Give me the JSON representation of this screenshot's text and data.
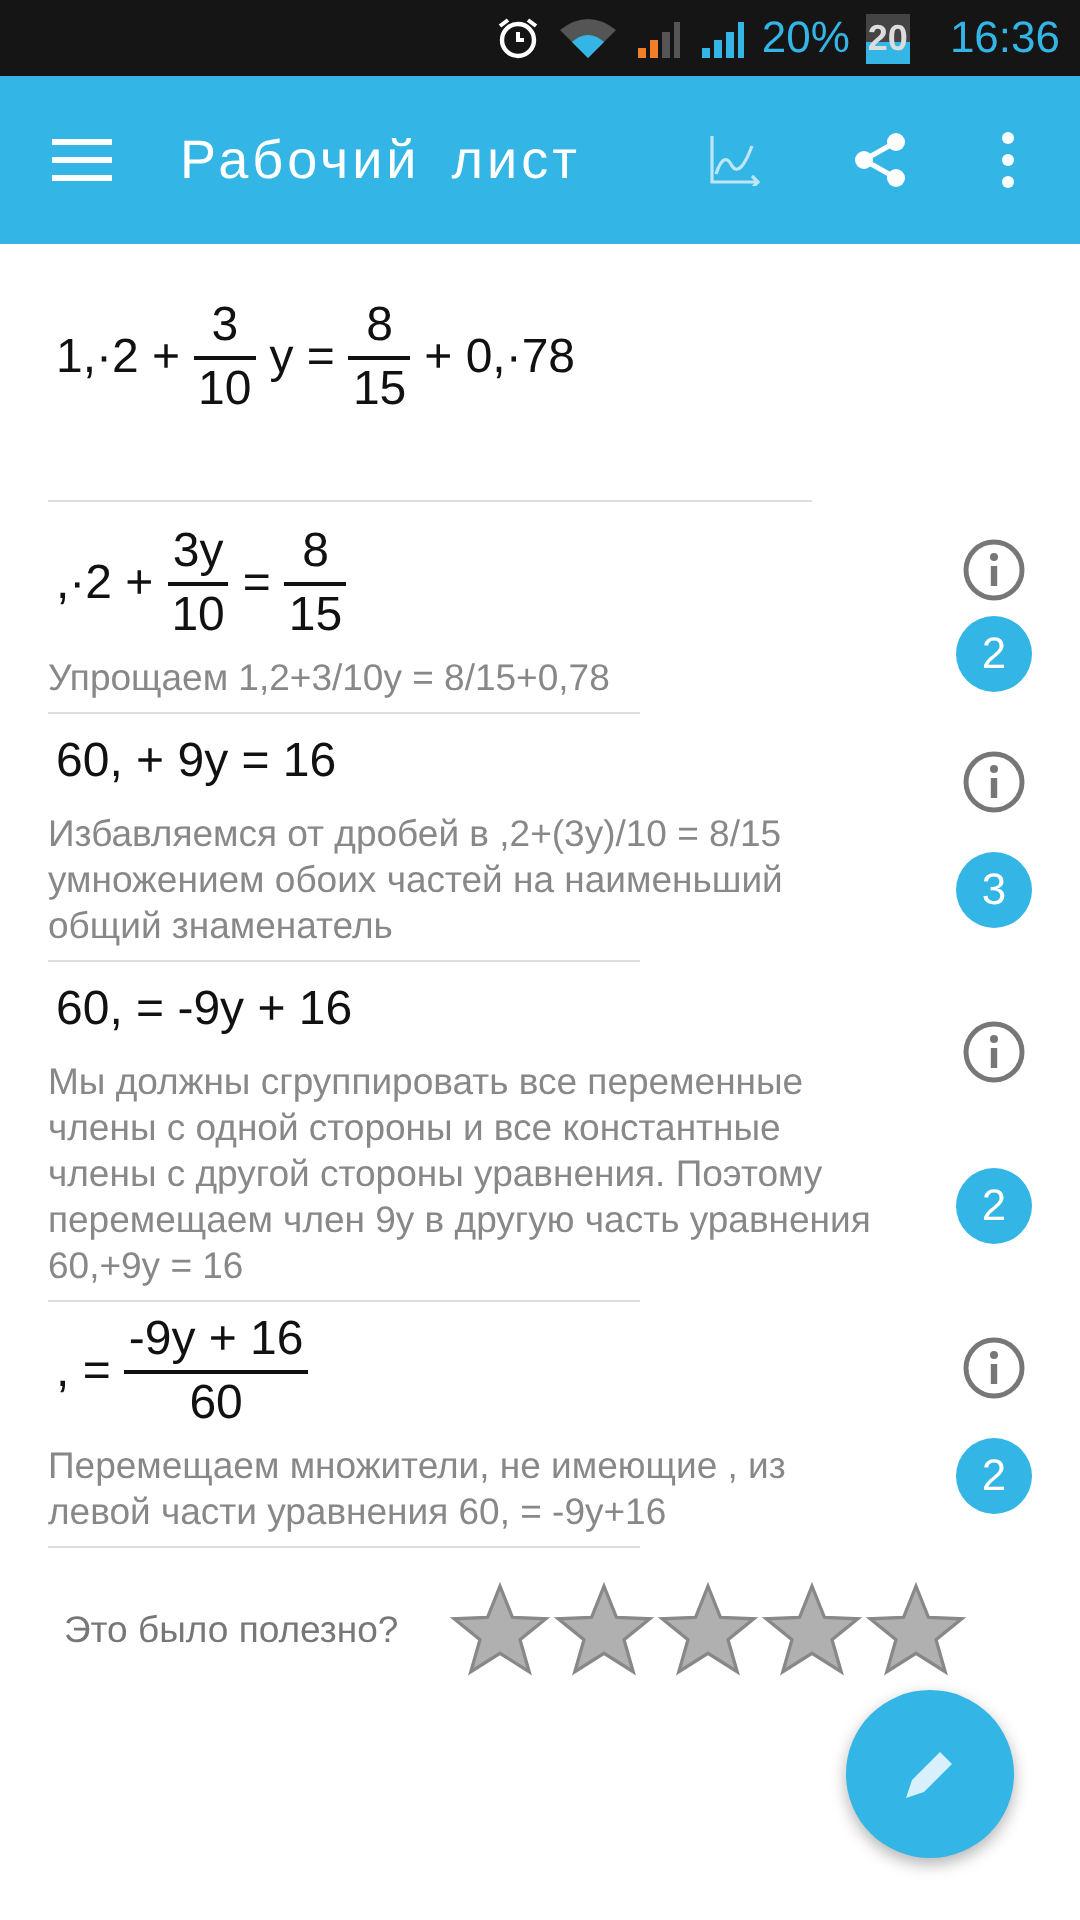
{
  "status_bar": {
    "battery_percent": "20%",
    "battery_level_text": "20",
    "time": "16:36"
  },
  "app_bar": {
    "title": "Рабочий лист"
  },
  "equation": [
    {
      "kind": "text",
      "text": "1,·2 +"
    },
    {
      "kind": "frac",
      "num": "3",
      "den": "10"
    },
    {
      "kind": "text",
      "text": "y ="
    },
    {
      "kind": "frac",
      "num": "8",
      "den": "15"
    },
    {
      "kind": "text",
      "text": "+ 0,·78"
    }
  ],
  "steps": [
    {
      "expression": [
        {
          "kind": "text",
          "text": ",·2 +"
        },
        {
          "kind": "frac",
          "num": "3y",
          "den": "10"
        },
        {
          "kind": "text",
          "text": "="
        },
        {
          "kind": "frac",
          "num": "8",
          "den": "15"
        }
      ],
      "explanation": "Упрощаем 1,2+3/10y = 8/15+0,78",
      "badge": "2"
    },
    {
      "expression": [
        {
          "kind": "text",
          "text": "60, + 9y = 16"
        }
      ],
      "explanation": "Избавляемся от дробей в ,2+(3y)/10 = 8/15 умножением обоих частей на наименьший общий знаменатель",
      "badge": "3"
    },
    {
      "expression": [
        {
          "kind": "text",
          "text": "60, = -9y + 16"
        }
      ],
      "explanation": "Мы должны сгруппировать все переменные члены с одной стороны и все константные члены с другой стороны уравнения. Поэтому перемещаем член 9y в другую часть уравнения 60,+9y = 16",
      "badge": "2"
    },
    {
      "expression": [
        {
          "kind": "text",
          "text": ", ="
        },
        {
          "kind": "frac",
          "num": "-9y + 16",
          "den": "60"
        }
      ],
      "explanation": "Перемещаем множители, не имеющие , из левой части уравнения 60, = -9y+16",
      "badge": "2"
    }
  ],
  "rating": {
    "question": "Это было полезно?",
    "stars": 0
  }
}
